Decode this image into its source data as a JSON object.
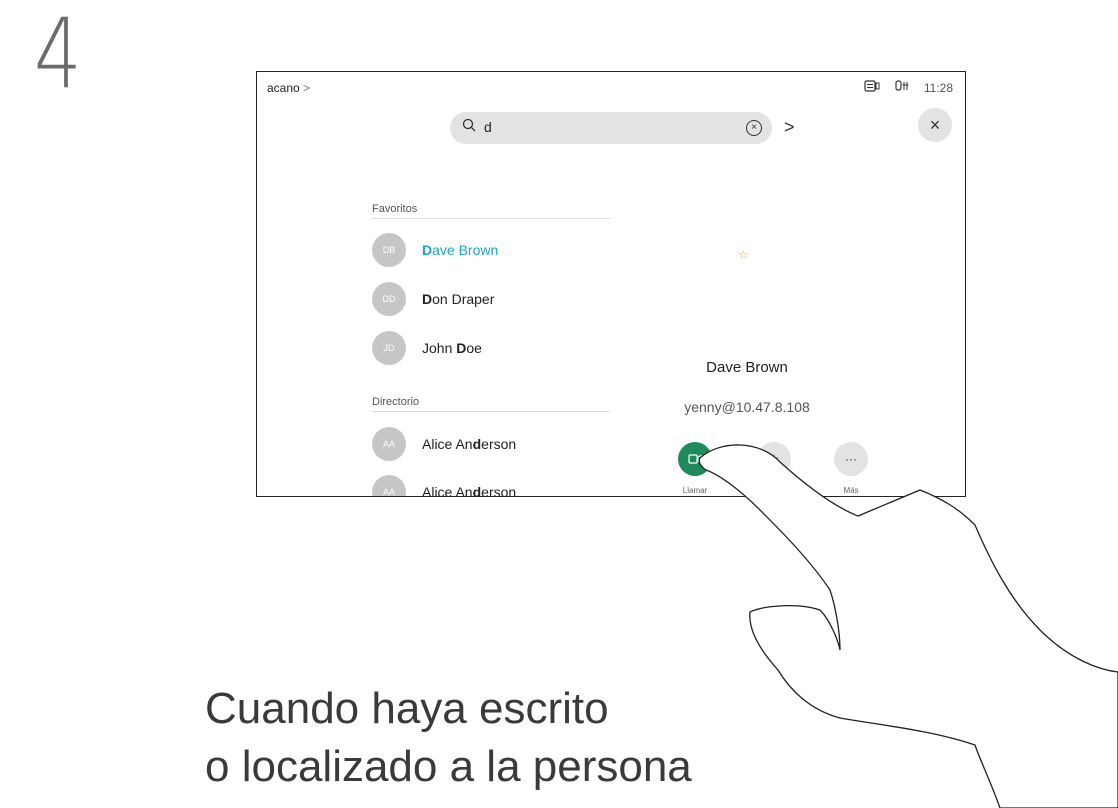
{
  "step_number": "4",
  "caption": {
    "line1": "Cuando haya escrito",
    "line2": "o localizado a la persona"
  },
  "device": {
    "brand": "acano",
    "brand_chevron": ">",
    "time": "11:28",
    "search": {
      "value": "d",
      "icon": "search-icon",
      "clear_icon": "clear-icon"
    },
    "next_icon": ">",
    "close_icon": "×",
    "favorites": {
      "heading": "Favoritos",
      "items": [
        {
          "initials": "DB",
          "pre": "",
          "bold": "D",
          "post": "ave Brown",
          "highlighted": true
        },
        {
          "initials": "DD",
          "pre": "",
          "bold": "D",
          "post": "on Draper",
          "highlighted": false
        },
        {
          "initials": "JD",
          "pre": "John ",
          "bold": "D",
          "post": "oe",
          "highlighted": false
        }
      ]
    },
    "directory": {
      "heading": "Directorio",
      "items": [
        {
          "initials": "AA",
          "pre": "Alice An",
          "bold": "d",
          "post": "erson"
        },
        {
          "initials": "AA",
          "pre": "Alice An",
          "bold": "d",
          "post": "erson"
        }
      ]
    },
    "detail": {
      "name": "Dave Brown",
      "address": "yenny@10.47.8.108",
      "favorite_icon": "star-icon"
    },
    "actions": {
      "call_label": "Llamar",
      "more_label": "Más",
      "more_glyph": "···"
    }
  },
  "colors": {
    "call_green": "#1f8a5b",
    "highlight_cyan": "#1aa7c6",
    "star_yellow": "#e2b000"
  }
}
